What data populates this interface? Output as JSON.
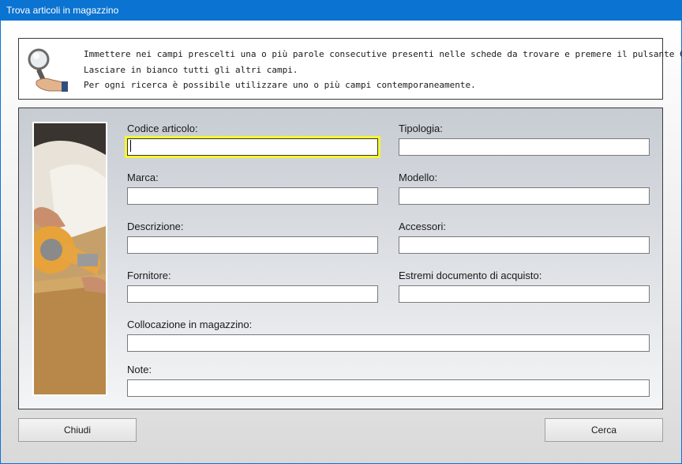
{
  "window": {
    "title": "Trova articoli in magazzino"
  },
  "info": {
    "lines": [
      "Immettere nei campi prescelti una o più parole consecutive presenti nelle schede da trovare e premere il pulsante Cerca.",
      "Lasciare in bianco tutti gli altri campi.",
      "Per ogni ricerca è possibile utilizzare uno o più campi contemporaneamente."
    ]
  },
  "form": {
    "codice_articolo": {
      "label": "Codice articolo:",
      "value": ""
    },
    "tipologia": {
      "label": "Tipologia:",
      "value": ""
    },
    "marca": {
      "label": "Marca:",
      "value": ""
    },
    "modello": {
      "label": "Modello:",
      "value": ""
    },
    "descrizione": {
      "label": "Descrizione:",
      "value": ""
    },
    "accessori": {
      "label": "Accessori:",
      "value": ""
    },
    "fornitore": {
      "label": "Fornitore:",
      "value": ""
    },
    "estremi_documento": {
      "label": "Estremi documento di acquisto:",
      "value": ""
    },
    "collocazione": {
      "label": "Collocazione in magazzino:",
      "value": ""
    },
    "note": {
      "label": "Note:",
      "value": ""
    }
  },
  "buttons": {
    "close_label": "Chiudi",
    "search_label": "Cerca"
  },
  "colors": {
    "titlebar": "#0b73d1",
    "focus_ring": "#f5f533"
  }
}
